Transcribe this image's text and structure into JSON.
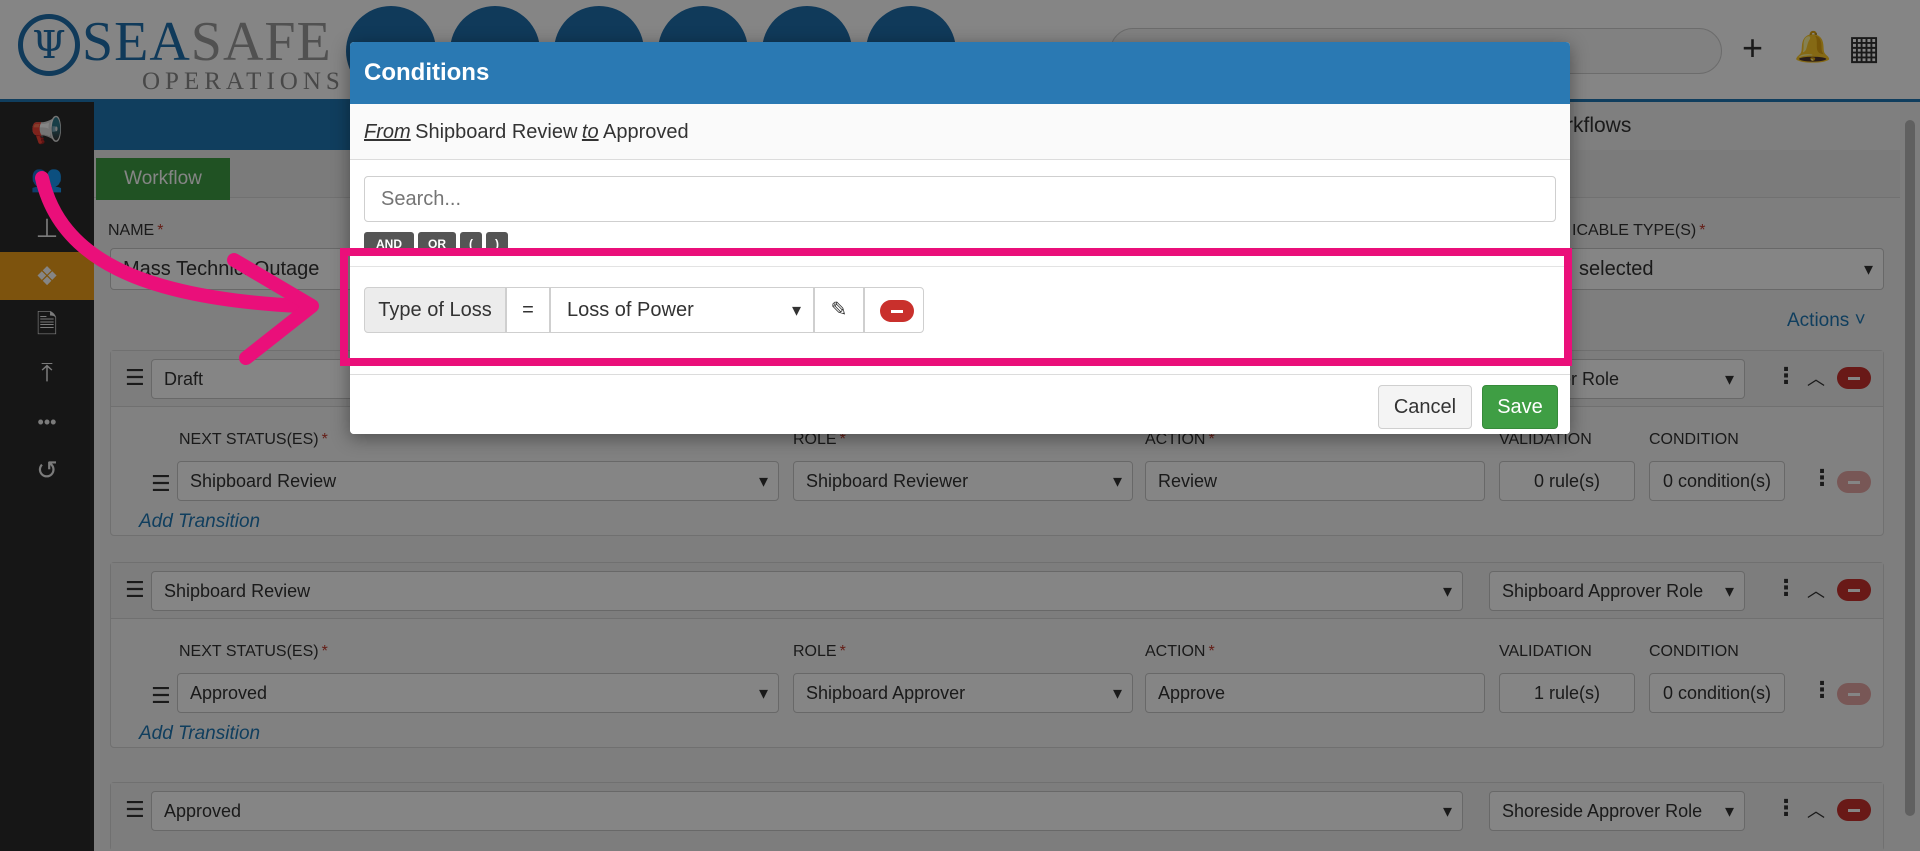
{
  "logo": {
    "sea": "SEA",
    "safe": "SAFE",
    "sub": "OPERATIONS",
    "mark": "Ψ"
  },
  "header": {
    "add_icon": "+",
    "bell_icon": "🔔",
    "grid_icon": "▦"
  },
  "sidebar": {
    "items": [
      {
        "icon": "megaphone-icon",
        "glyph": "📢"
      },
      {
        "icon": "users-icon",
        "glyph": "👥"
      },
      {
        "icon": "stamp-icon",
        "glyph": "⊥"
      },
      {
        "icon": "workflow-icon",
        "glyph": "❖"
      },
      {
        "icon": "document-icon",
        "glyph": "🗎"
      },
      {
        "icon": "upload-icon",
        "glyph": "⤒"
      },
      {
        "icon": "more-icon",
        "glyph": "•••"
      },
      {
        "icon": "history-icon",
        "glyph": "↺"
      }
    ]
  },
  "page": {
    "tab_label": "rkflows",
    "workflow_tab": "Workflow",
    "name_label": "NAME",
    "name_value": "Mass Technic",
    "name_value_tail": "l Outage",
    "applicable_label": "ICABLE TYPE(S)",
    "applicable_value": "selected",
    "actions_link": "Actions ˅"
  },
  "statuses": [
    {
      "status": "Draft",
      "role_select": "Reviewer Role",
      "next_status": "Shipboard Review",
      "role": "Shipboard Reviewer",
      "action": "Review",
      "validation": "0 rule(s)",
      "condition": "0 condition(s)"
    },
    {
      "status": "Shipboard Review",
      "role_select": "Shipboard Approver Role",
      "next_status": "Approved",
      "role": "Shipboard Approver",
      "action": "Approve",
      "validation": "1 rule(s)",
      "condition": "0 condition(s)"
    },
    {
      "status": "Approved",
      "role_select": "Shoreside Approver Role"
    }
  ],
  "columns": {
    "next_status": "NEXT STATUS(ES)",
    "role": "ROLE",
    "action": "ACTION",
    "validation": "VALIDATION",
    "condition": "CONDITION",
    "add_transition": "Add Transition"
  },
  "dialog": {
    "title": "Conditions",
    "from_word": "From",
    "from_value": "Shipboard Review",
    "to_word": "to",
    "to_value": "Approved",
    "search_placeholder": "Search...",
    "logic_buttons": [
      "AND",
      "OR",
      "(",
      ")"
    ],
    "condition": {
      "field": "Type of Loss",
      "operator": "=",
      "value": "Loss of Power"
    },
    "cancel_label": "Cancel",
    "save_label": "Save"
  },
  "colors": {
    "primary": "#2a79b3",
    "success": "#3f9e44",
    "danger": "#c9302c",
    "highlight": "#ea0f7a",
    "sidebar_active": "#f0a019"
  }
}
